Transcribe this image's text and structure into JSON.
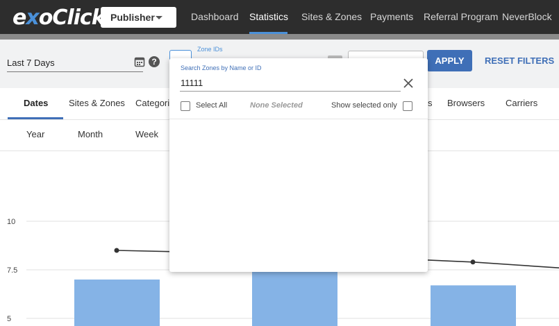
{
  "brand": {
    "logo_part1": "e",
    "logo_part2": "x",
    "logo_part3": "oClick",
    "accent_color": "#4a90d9",
    "primary_color": "#3f6fb7"
  },
  "header": {
    "account_selector": "Publisher",
    "nav": [
      {
        "label": "Dashboard"
      },
      {
        "label": "Statistics"
      },
      {
        "label": "Sites & Zones"
      },
      {
        "label": "Payments"
      },
      {
        "label": "Referral Program"
      },
      {
        "label": "NeverBlock"
      }
    ],
    "active_nav": "Statistics"
  },
  "filters": {
    "date_range": "Last 7 Days",
    "zone_ids_label": "Zone IDs",
    "apply_label": "APPLY",
    "reset_label": "RESET FILTERS"
  },
  "tabs": {
    "items": [
      {
        "label": "Dates"
      },
      {
        "label": "Sites & Zones"
      },
      {
        "label": "Categori"
      },
      {
        "label": "s"
      },
      {
        "label": "Browsers"
      },
      {
        "label": "Carriers"
      }
    ],
    "active": "Dates"
  },
  "subtabs": [
    {
      "label": "Year"
    },
    {
      "label": "Month"
    },
    {
      "label": "Week"
    }
  ],
  "zone_dropdown": {
    "search_label": "Search Zones by Name or ID",
    "search_value": "11111",
    "select_all_label": "Select All",
    "selection_status": "None Selected",
    "show_selected_label": "Show selected only"
  },
  "chart_data": {
    "type": "bar",
    "y_ticks": [
      "10",
      "7.5",
      "5"
    ],
    "bars": [
      7.0,
      7.5,
      6.7
    ],
    "line": [
      8.5,
      8.3,
      7.9,
      7.6
    ],
    "bar_color": "#85b3e6",
    "line_color": "#333333"
  }
}
